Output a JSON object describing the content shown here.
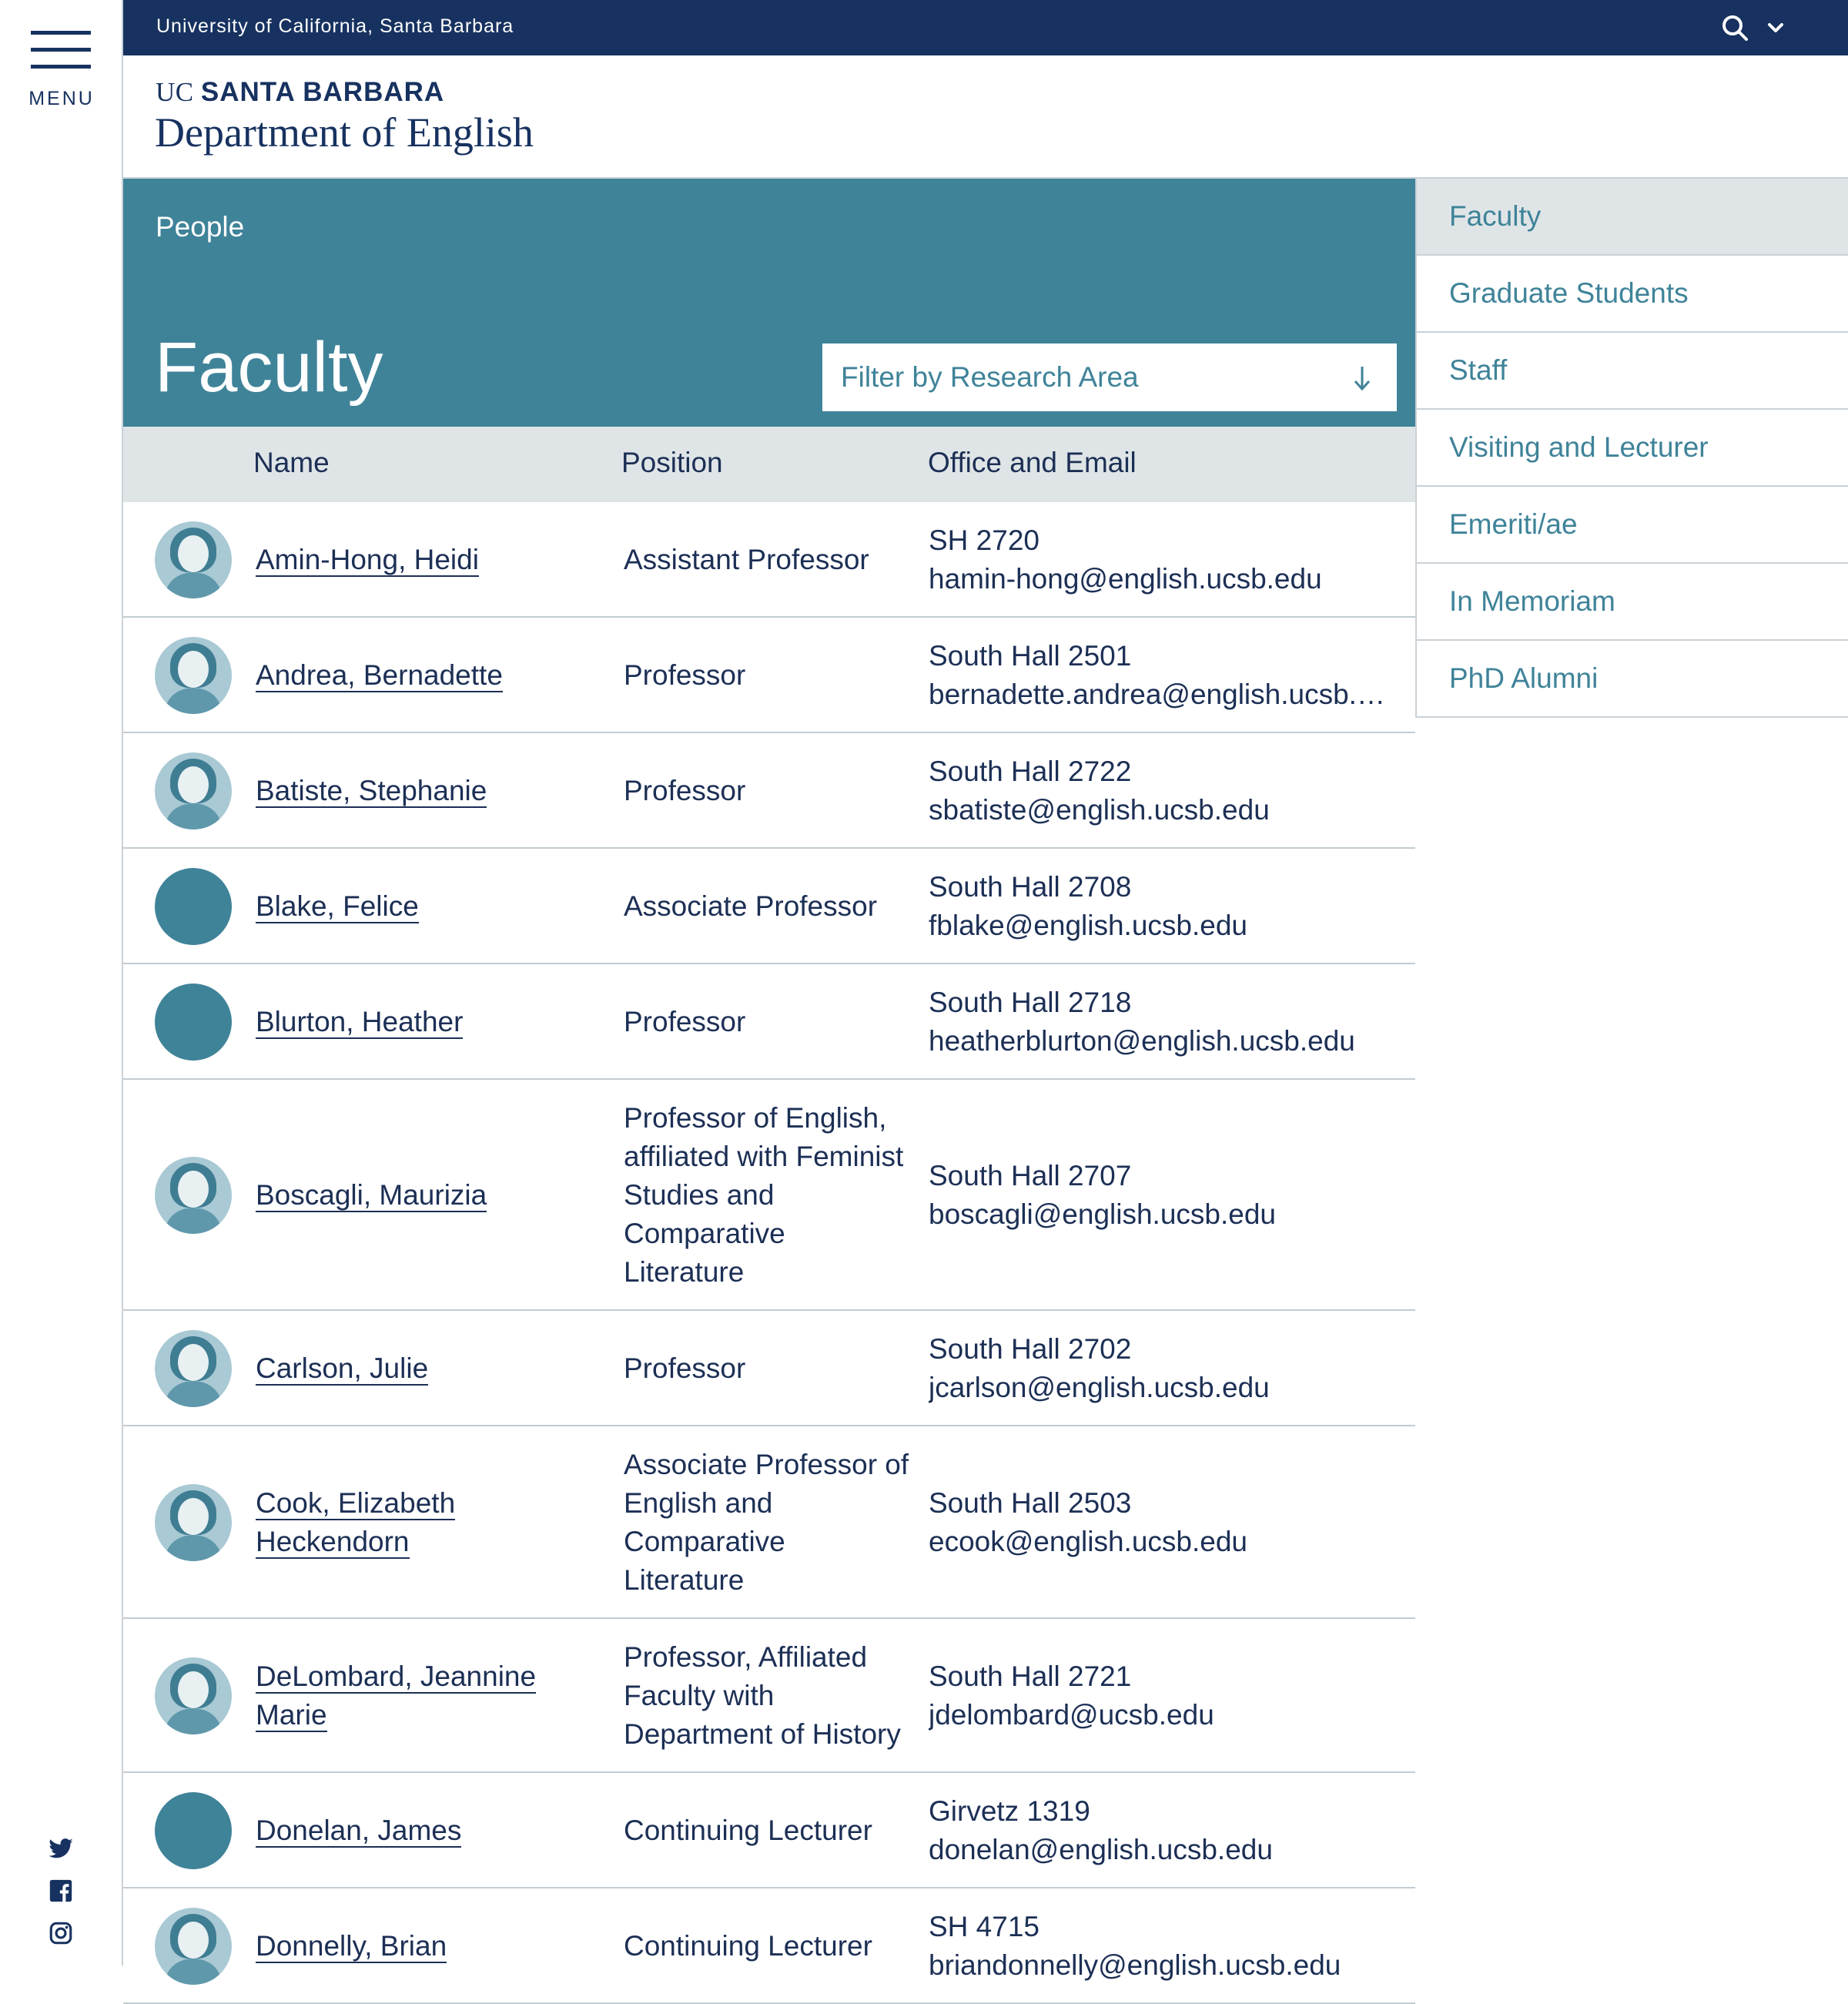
{
  "topbar": {
    "university": "University of California, Santa Barbara"
  },
  "rail": {
    "menu_label": "MENU"
  },
  "brand": {
    "prefix": "UC ",
    "strong": "SANTA BARBARA",
    "department": "Department of English"
  },
  "hero": {
    "breadcrumb": "People",
    "title": "Faculty",
    "filter_placeholder": "Filter by Research Area"
  },
  "table": {
    "headers": {
      "name": "Name",
      "position": "Position",
      "office": "Office and Email"
    },
    "rows": [
      {
        "name": [
          "Amin-Hong, Heidi"
        ],
        "position": [
          "Assistant Professor"
        ],
        "office": "SH 2720",
        "email": "hamin-hong@english.ucsb.edu",
        "photo": true
      },
      {
        "name": [
          "Andrea, Bernadette"
        ],
        "position": [
          "Professor"
        ],
        "office": "South Hall 2501",
        "email": "bernadette.andrea@english.ucsb.…",
        "photo": true
      },
      {
        "name": [
          "Batiste, Stephanie"
        ],
        "position": [
          "Professor"
        ],
        "office": "South Hall 2722",
        "email": "sbatiste@english.ucsb.edu",
        "photo": true
      },
      {
        "name": [
          "Blake, Felice"
        ],
        "position": [
          "Associate Professor"
        ],
        "office": "South Hall 2708",
        "email": "fblake@english.ucsb.edu",
        "photo": false
      },
      {
        "name": [
          "Blurton, Heather"
        ],
        "position": [
          "Professor"
        ],
        "office": "South Hall 2718",
        "email": "heatherblurton@english.ucsb.edu",
        "photo": false
      },
      {
        "name": [
          "Boscagli, Maurizia"
        ],
        "position": [
          "Professor of English,",
          "affiliated with Feminist",
          "Studies and",
          "Comparative",
          "Literature"
        ],
        "office": "South Hall 2707",
        "email": "boscagli@english.ucsb.edu",
        "photo": true
      },
      {
        "name": [
          "Carlson, Julie"
        ],
        "position": [
          "Professor"
        ],
        "office": "South Hall 2702",
        "email": "jcarlson@english.ucsb.edu",
        "photo": true
      },
      {
        "name": [
          "Cook, Elizabeth",
          "Heckendorn"
        ],
        "position": [
          "Associate Professor of",
          "English and",
          "Comparative",
          "Literature"
        ],
        "office": "South Hall 2503",
        "email": "ecook@english.ucsb.edu",
        "photo": true
      },
      {
        "name": [
          "DeLombard, Jeannine",
          "Marie"
        ],
        "position": [
          "Professor, Affiliated",
          "Faculty with",
          "Department of History"
        ],
        "office": "South Hall 2721",
        "email": "jdelombard@ucsb.edu",
        "photo": true
      },
      {
        "name": [
          "Donelan, James"
        ],
        "position": [
          "Continuing Lecturer"
        ],
        "office": "Girvetz 1319",
        "email": "donelan@english.ucsb.edu",
        "photo": false
      },
      {
        "name": [
          "Donnelly, Brian"
        ],
        "position": [
          "Continuing Lecturer"
        ],
        "office": "SH 4715",
        "email": "briandonnelly@english.ucsb.edu",
        "photo": true
      }
    ]
  },
  "sidebar": {
    "items": [
      {
        "label": "Faculty",
        "active": true
      },
      {
        "label": "Graduate Students"
      },
      {
        "label": "Staff"
      },
      {
        "label": "Visiting and Lecturer"
      },
      {
        "label": "Emeriti/ae"
      },
      {
        "label": "In Memoriam"
      },
      {
        "label": "PhD Alumni"
      }
    ]
  },
  "social": [
    "twitter-icon",
    "facebook-icon",
    "instagram-icon"
  ],
  "colors": {
    "navy": "#173260",
    "teal": "#3f8399",
    "light": "#dfe5e7"
  }
}
